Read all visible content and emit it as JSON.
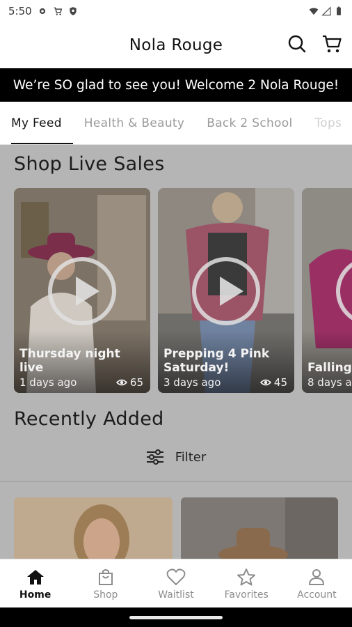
{
  "status_bar": {
    "time": "5:50"
  },
  "header": {
    "title": "Nola Rouge"
  },
  "banner": {
    "text": "We’re SO glad to see you! Welcome 2 Nola Rouge!"
  },
  "tabs": [
    {
      "label": "My Feed"
    },
    {
      "label": "Health & Beauty"
    },
    {
      "label": "Back 2 School"
    },
    {
      "label": "Tops"
    }
  ],
  "live_sales": {
    "title": "Shop Live Sales",
    "cards": [
      {
        "title": "Thursday night live",
        "age": "1 days ago",
        "views": "65"
      },
      {
        "title": "Prepping 4 Pink Saturday!",
        "age": "3 days ago",
        "views": "45"
      },
      {
        "title": "Falling",
        "age": "8 days a",
        "views": ""
      }
    ]
  },
  "recently_added": {
    "title": "Recently Added",
    "filter_label": "Filter"
  },
  "bottom_nav": [
    {
      "label": "Home",
      "icon": "home-icon"
    },
    {
      "label": "Shop",
      "icon": "bag-icon"
    },
    {
      "label": "Waitlist",
      "icon": "heart-icon"
    },
    {
      "label": "Favorites",
      "icon": "star-icon"
    },
    {
      "label": "Account",
      "icon": "person-icon"
    }
  ],
  "colors": {
    "banner_bg": "#000000",
    "overlay": "#b5b5b5",
    "active_text": "#111111",
    "inactive_text": "#8c8c8c"
  }
}
